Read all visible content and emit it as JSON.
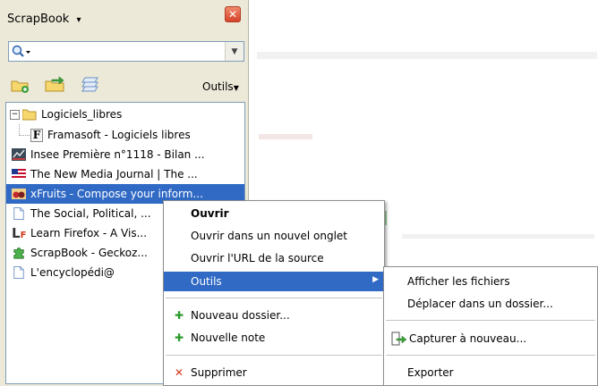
{
  "sidebar": {
    "title": "ScrapBook",
    "title_arrow": "▾",
    "close_glyph": "✕",
    "outils_label": "Outils"
  },
  "tree": {
    "items": [
      {
        "label": "Logiciels_libres",
        "icon": "folder-icon"
      },
      {
        "label": "Framasoft - Logiciels libres",
        "icon": "framasoft-f-icon"
      },
      {
        "label": "Insee Première n°1118 - Bilan ...",
        "icon": "insee-icon"
      },
      {
        "label": "The New Media Journal | The ...",
        "icon": "us-flag-icon"
      },
      {
        "label": "xFruits - Compose your inform...",
        "icon": "xfruits-icon"
      },
      {
        "label": "The Social, Political, ...",
        "icon": "page-icon"
      },
      {
        "label": "Learn Firefox - A Vis...",
        "icon": "lf-icon"
      },
      {
        "label": "ScrapBook - Geckoz...",
        "icon": "puzzle-icon"
      },
      {
        "label": "L'encyclopédi@",
        "icon": "page-icon"
      }
    ],
    "expander": "−",
    "framasoft_letter": "F",
    "lf_letter": "L",
    "lf_sub": "F"
  },
  "context_menu": {
    "items": [
      {
        "label": "Ouvrir",
        "bold": true
      },
      {
        "label": "Ouvrir dans un nouvel onglet"
      },
      {
        "label": "Ouvrir l'URL de la source"
      },
      {
        "label": "Outils",
        "submenu": true,
        "highlighted": true
      },
      {
        "label": "Nouveau dossier...",
        "icon": "plus-icon"
      },
      {
        "label": "Nouvelle note",
        "icon": "plus-icon"
      },
      {
        "label": "Supprimer",
        "icon": "x-icon"
      }
    ],
    "submenu_arrow": "▶",
    "plus_glyph": "✚",
    "x_glyph": "✕"
  },
  "submenu": {
    "items": [
      {
        "label": "Afficher les fichiers"
      },
      {
        "label": "Déplacer dans un dossier..."
      },
      {
        "label": "Capturer à nouveau...",
        "icon": "capture-icon"
      },
      {
        "label": "Exporter"
      }
    ]
  },
  "colors": {
    "selection": "#316ac5",
    "sidebar_bg": "#ece9d8",
    "green_plus": "#2c9a2c",
    "red_x": "#d4381c"
  }
}
